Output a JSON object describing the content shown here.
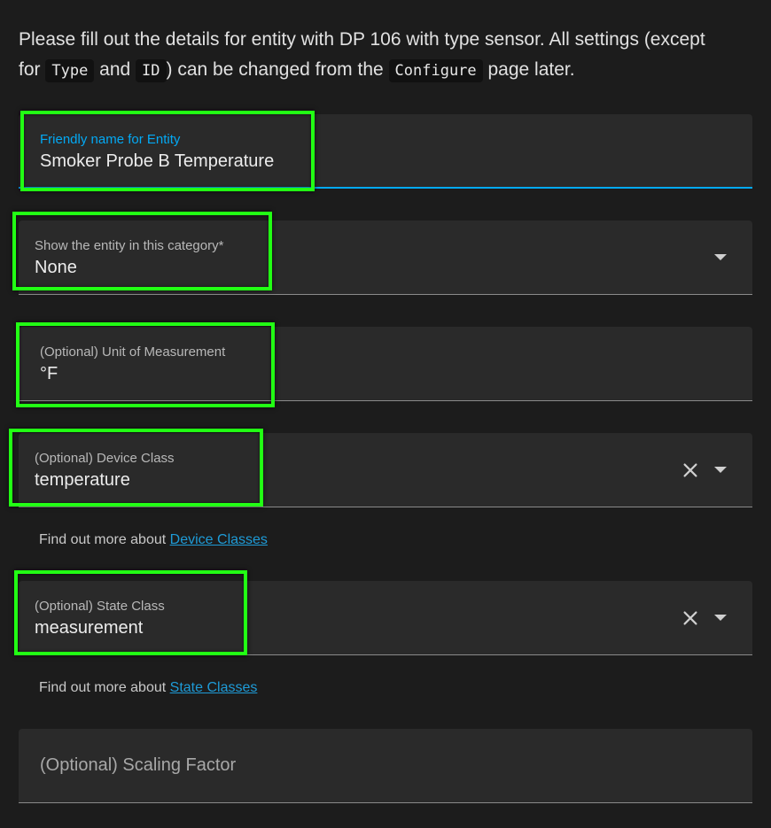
{
  "intro": {
    "part1": "Please fill out the details for entity with DP 106 with type sensor. All settings (except for",
    "code_type": "Type",
    "and": "and",
    "code_id": "ID",
    "part2": ") can be changed from the",
    "code_configure": "Configure",
    "part3": "page later."
  },
  "fields": {
    "friendly_name": {
      "label": "Friendly name for Entity",
      "value": "Smoker Probe B Temperature"
    },
    "category": {
      "label": "Show the entity in this category*",
      "value": "None"
    },
    "unit": {
      "label": "(Optional) Unit of Measurement",
      "value": "°F"
    },
    "device_class": {
      "label": "(Optional) Device Class",
      "value": "temperature"
    },
    "state_class": {
      "label": "(Optional) State Class",
      "value": "measurement"
    },
    "scaling": {
      "placeholder": "(Optional) Scaling Factor"
    }
  },
  "helpers": {
    "device_class": {
      "text": "Find out more about",
      "link": "Device Classes"
    },
    "state_class": {
      "text": "Find out more about",
      "link": "State Classes"
    }
  },
  "colors": {
    "focus_blue": "#03a9f4",
    "highlight_green": "#22ff14",
    "link_blue": "#1e9bd7"
  },
  "icons": [
    "dropdown-arrow-icon",
    "clear-icon"
  ]
}
